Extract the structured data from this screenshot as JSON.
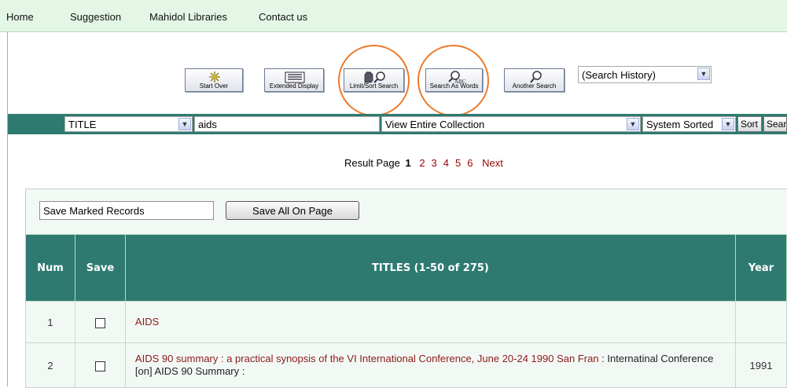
{
  "nav": {
    "home": "Home",
    "suggestion": "Suggestion",
    "libraries": "Mahidol Libraries",
    "contact": "Contact us"
  },
  "toolbar": {
    "start_over": "Start Over",
    "extended_display": "Extended Display",
    "limit_sort": "Limit/Sort Search",
    "search_as_words": "Search As Words",
    "another_search": "Another Search",
    "history_value": "(Search History)",
    "highlight_color": "#ec7a2c"
  },
  "search": {
    "index": "TITLE",
    "query": "aids",
    "scope": "View Entire Collection",
    "sort": "System Sorted",
    "sort_button": "Sort",
    "search_button": "Search"
  },
  "pager": {
    "label": "Result Page",
    "current": "1",
    "pages": [
      "2",
      "3",
      "4",
      "5",
      "6"
    ],
    "next": "Next"
  },
  "results": {
    "save_marked": "Save Marked Records",
    "save_all": "Save All On Page",
    "headers": {
      "num": "Num",
      "save": "Save",
      "titles": "TITLES (1-50 of 275)",
      "year": "Year"
    },
    "rows": [
      {
        "num": "1",
        "title": "AIDS",
        "extra": "",
        "year": ""
      },
      {
        "num": "2",
        "title": "AIDS 90 summary : a practical synopsis of the VI International Conference, June 20-24 1990 San Fran",
        "extra": " : Internatinal Conference [on] AIDS 90 Summary :",
        "year": "1991"
      }
    ]
  },
  "colors": {
    "nav_bg": "#e4f7e7",
    "header_bg": "#2e7a71",
    "link": "#8b1a1a"
  }
}
